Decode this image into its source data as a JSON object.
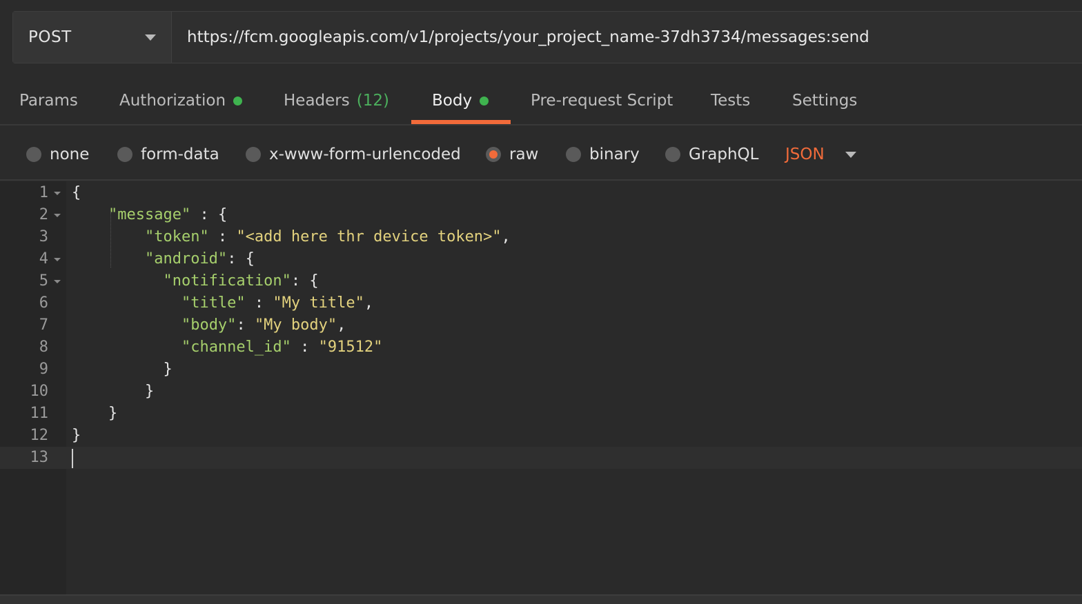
{
  "request": {
    "method": "POST",
    "url": "https://fcm.googleapis.com/v1/projects/your_project_name-37dh3734/messages:send"
  },
  "tabs": [
    {
      "label": "Params"
    },
    {
      "label": "Authorization",
      "dot": "green"
    },
    {
      "label": "Headers",
      "count": "(12)"
    },
    {
      "label": "Body",
      "dot": "green",
      "active": true
    },
    {
      "label": "Pre-request Script"
    },
    {
      "label": "Tests"
    },
    {
      "label": "Settings"
    }
  ],
  "body_types": [
    {
      "label": "none",
      "selected": false
    },
    {
      "label": "form-data",
      "selected": false
    },
    {
      "label": "x-www-form-urlencoded",
      "selected": false
    },
    {
      "label": "raw",
      "selected": true
    },
    {
      "label": "binary",
      "selected": false
    },
    {
      "label": "GraphQL",
      "selected": false
    }
  ],
  "format": "JSON",
  "colors": {
    "accent": "#f26b3a",
    "dot": "#3fb34f",
    "key": "#a6cf6c",
    "string": "#e3d27e"
  },
  "editor": {
    "line_numbers": [
      "1",
      "2",
      "3",
      "4",
      "5",
      "6",
      "7",
      "8",
      "9",
      "10",
      "11",
      "12",
      "13"
    ],
    "lines": [
      "{",
      "    \"message\" : {",
      "        \"token\" : \"<add here thr device token>\",",
      "        \"android\": {",
      "          \"notification\": {",
      "            \"title\" : \"My title\",",
      "            \"body\": \"My body\",",
      "            \"channel_id\" : \"91512\"",
      "          }",
      "        }",
      "    }",
      "}",
      ""
    ]
  }
}
